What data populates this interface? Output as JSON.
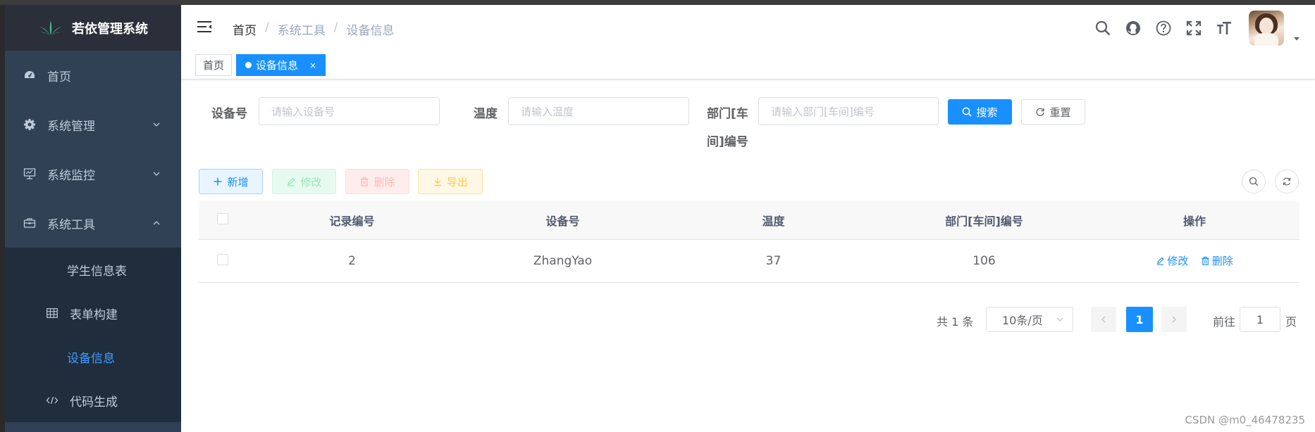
{
  "app": {
    "title": "若依管理系统"
  },
  "sidebar": {
    "items": [
      {
        "label": "首页",
        "icon": "dashboard-icon"
      },
      {
        "label": "系统管理",
        "icon": "gear-icon"
      },
      {
        "label": "系统监控",
        "icon": "monitor-icon"
      },
      {
        "label": "系统工具",
        "icon": "toolbox-icon"
      }
    ],
    "subitems": [
      {
        "label": "学生信息表"
      },
      {
        "label": "表单构建",
        "icon": "table-icon"
      },
      {
        "label": "设备信息",
        "active": true
      },
      {
        "label": "代码生成",
        "icon": "code-icon"
      }
    ]
  },
  "breadcrumb": {
    "home": "首页",
    "sep1": "/",
    "mid": "系统工具",
    "sep2": "/",
    "current": "设备信息"
  },
  "tags": {
    "home": "首页",
    "active": "设备信息",
    "close": "×"
  },
  "search": {
    "device_label": "设备号",
    "device_placeholder": "请输入设备号",
    "temp_label": "温度",
    "temp_placeholder": "请输入温度",
    "dept_label_line1": "部门[车",
    "dept_label_line2": "间]编号",
    "dept_placeholder": "请输入部门[车间]编号",
    "search_btn": "搜索",
    "reset_btn": "重置"
  },
  "toolbar": {
    "add": "新增",
    "edit": "修改",
    "delete": "删除",
    "export": "导出"
  },
  "table": {
    "headers": [
      "记录编号",
      "设备号",
      "温度",
      "部门[车间]编号",
      "操作"
    ],
    "rows": [
      {
        "id": "2",
        "device": "ZhangYao",
        "temp": "37",
        "dept": "106",
        "edit": "修改",
        "delete": "删除"
      }
    ]
  },
  "pagination": {
    "total": "共 1 条",
    "page_size": "10条/页",
    "current": "1",
    "goto_label": "前往",
    "goto_value": "1",
    "page_suffix": "页"
  },
  "watermark": "CSDN @m0_46478235",
  "colors": {
    "primary": "#1890ff",
    "sidebar_bg": "#304156",
    "submenu_bg": "#1f2d3d",
    "active_text": "#409eff"
  }
}
